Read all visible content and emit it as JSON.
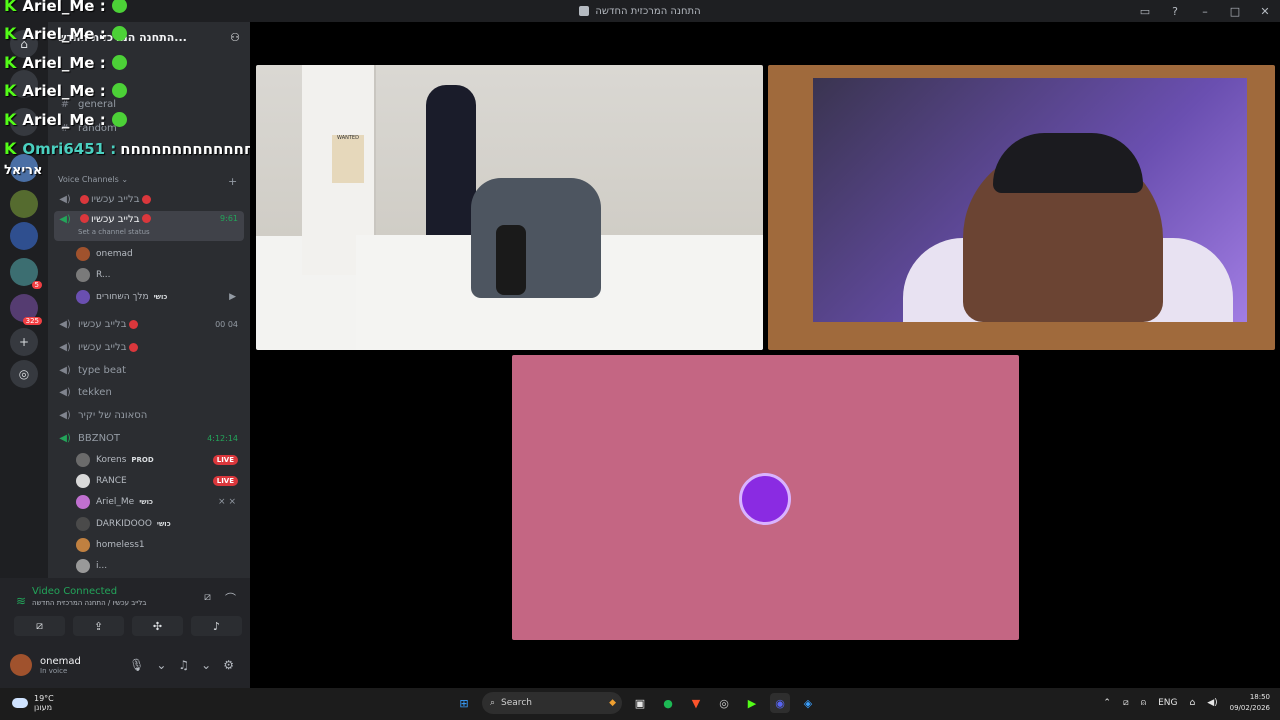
{
  "window": {
    "title": "התחנה המרכזית החדשה"
  },
  "server": {
    "name": "התחנה המרכזית החדש..."
  },
  "text_channels": [
    {
      "name": "general"
    },
    {
      "name": "random"
    }
  ],
  "voice_category": {
    "label": "Voice Channels"
  },
  "voice_channels": [
    {
      "name": "בלייב עכשיו",
      "right": ""
    },
    {
      "name": "בלייב עכשיו",
      "right": "9:61",
      "status": "Set a channel status"
    },
    {
      "name": "בלייב עכשיו",
      "right": "00 04"
    },
    {
      "name": "בלייב עכשיו",
      "right": ""
    },
    {
      "name": "type beat",
      "right": ""
    },
    {
      "name": "tekken",
      "right": ""
    },
    {
      "name": "הסאונה של יקיר",
      "right": ""
    },
    {
      "name": "BBZNOT",
      "right": "4:12:14"
    }
  ],
  "members_channel2": [
    {
      "name": "onemad",
      "color": "#a0522d"
    },
    {
      "name": "R...",
      "color": "#7a7a7a"
    },
    {
      "name": "מלך השחורים",
      "tag": "כושי",
      "color": "#6a4fb0"
    }
  ],
  "members_bbznot": [
    {
      "name": "Korens",
      "tag": "PROD",
      "live": "LIVE",
      "color": "#6b6b6b"
    },
    {
      "name": "RANCE",
      "live": "LIVE",
      "color": "#d9d9d9"
    },
    {
      "name": "Ariel_Me",
      "tag": "כושי",
      "color": "#c070d0"
    },
    {
      "name": "DARKIDOOO",
      "tag": "כושי",
      "color": "#4a4a4a"
    },
    {
      "name": "homeless1",
      "color": "#c08040"
    },
    {
      "name": "i...",
      "color": "#999999"
    }
  ],
  "chat_overlay": [
    {
      "user": "Ariel_Me :",
      "text": ""
    },
    {
      "user": "Ariel_Me :",
      "text": ""
    },
    {
      "user": "Ariel_Me :",
      "text": ""
    },
    {
      "user": "Ariel_Me :",
      "text": ""
    },
    {
      "user": "Ariel_Me :",
      "text": ""
    },
    {
      "user": "Omri6451 :",
      "text": "חחחחחחחחחחחחח"
    }
  ],
  "overlay_side_label": "אריאל",
  "guild_badges": {
    "b1": "5",
    "b2": "325"
  },
  "voice_panel": {
    "status": "Video Connected",
    "channel": "בלייב עכשיו / התחנה המרכזית החדשה"
  },
  "user": {
    "name": "onemad",
    "status": "In voice"
  },
  "tile1": {
    "poster": "WANTED"
  },
  "taskbar": {
    "temp": "19°C",
    "weather": "מעונן",
    "search": "Search",
    "lang": "ENG",
    "time": "18:50",
    "date": "09/02/2026"
  }
}
